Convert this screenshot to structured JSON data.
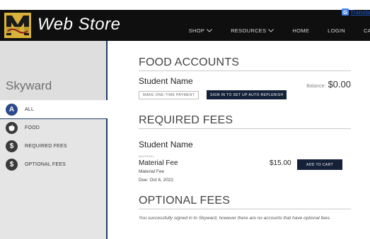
{
  "translate": {
    "label": "Transla"
  },
  "header": {
    "title": "Web Store",
    "nav": [
      {
        "label": "SHOP",
        "dropdown": true
      },
      {
        "label": "RESOURCES",
        "dropdown": true
      },
      {
        "label": "HOME",
        "dropdown": false
      },
      {
        "label": "LOGIN",
        "dropdown": false
      },
      {
        "label": "CA",
        "dropdown": false
      }
    ]
  },
  "sidebar": {
    "title": "Skyward",
    "items": [
      {
        "label": "ALL",
        "icon": "A"
      },
      {
        "label": "FOOD",
        "icon": "apple-icon"
      },
      {
        "label": "REQUIRED FEES",
        "icon": "$"
      },
      {
        "label": "OPTIONAL FEES",
        "icon": "$"
      }
    ]
  },
  "food": {
    "title": "FOOD ACCOUNTS",
    "student": "Student Name",
    "balance_label": "Balance:",
    "balance_value": "$0.00",
    "payment_button": "MAKE ONE-TIME PAYMENT",
    "auto_button": "SIGN IN TO SET UP AUTO REPLENISH"
  },
  "required": {
    "title": "REQUIRED FEES",
    "student": "Student Name",
    "category": "MATERIAL",
    "fee_name": "Material Fee",
    "fee_amount": "$15.00",
    "fee_desc": "Material Fee",
    "due": "Due: Oct 6, 2022",
    "cart_button": "ADD TO CART"
  },
  "optional": {
    "title": "OPTIONAL FEES",
    "note": "You successfully signed in to Skyward, however there are no accounts that have optional fees."
  },
  "colors": {
    "header_bg": "#0f0f0f",
    "accent_navy": "#142138",
    "sidebar_bg": "#e5e5e5"
  }
}
